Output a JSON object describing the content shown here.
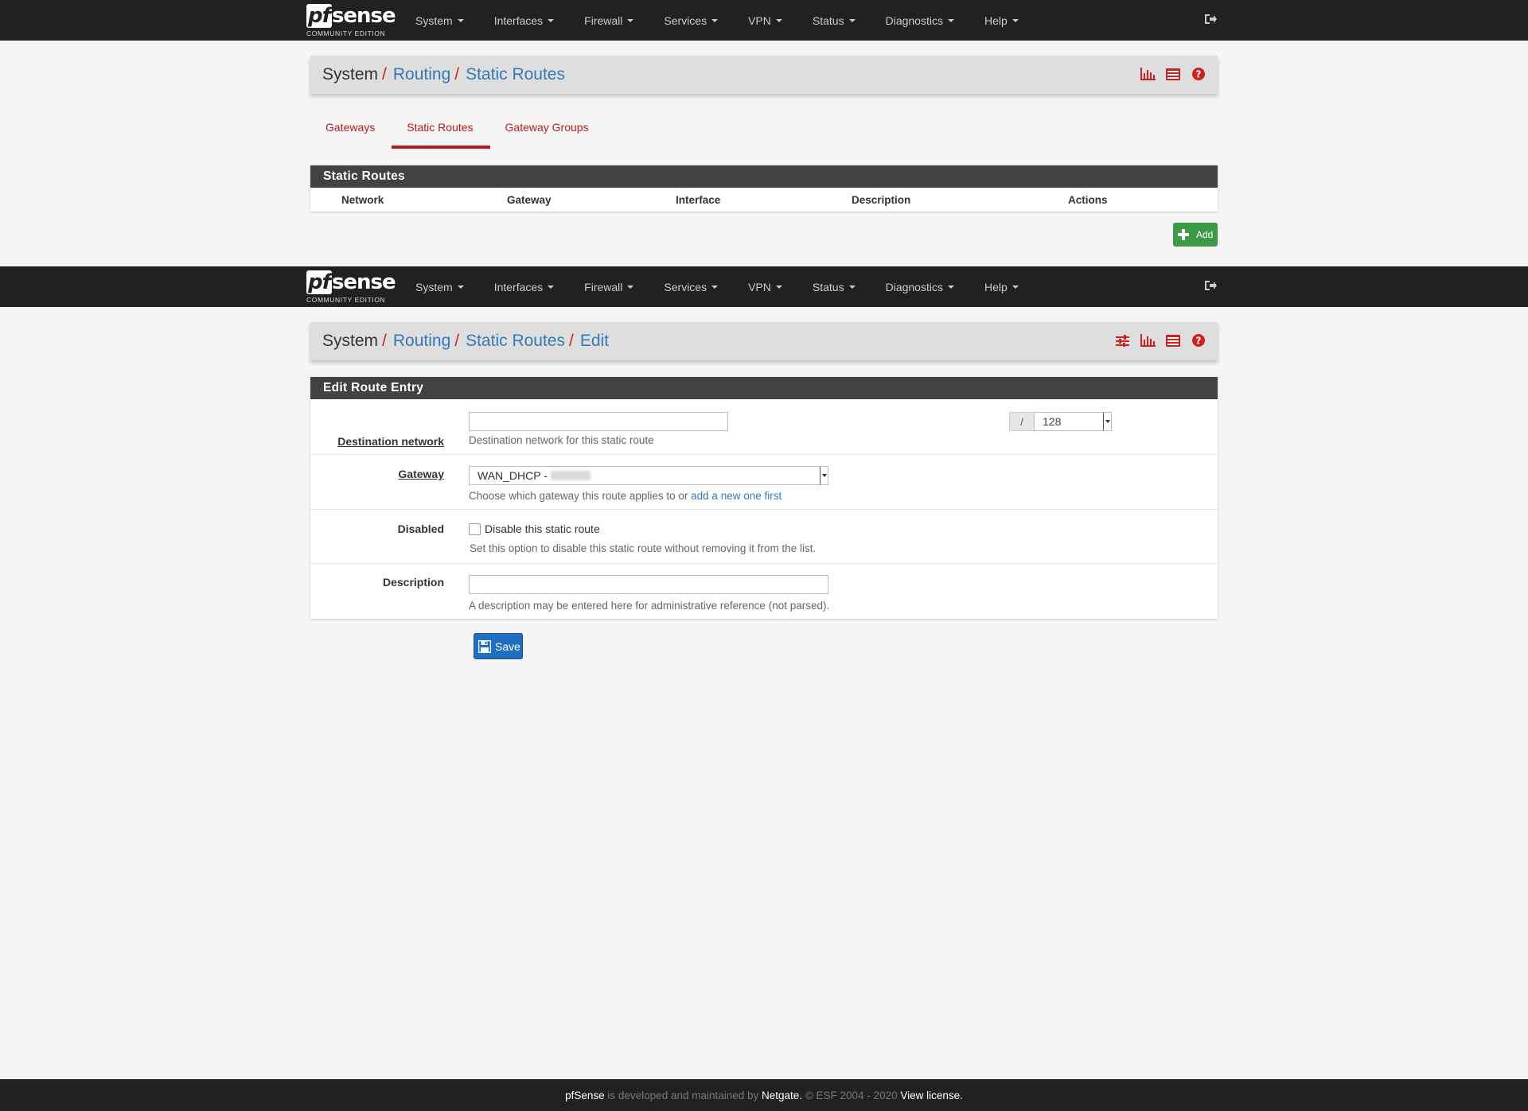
{
  "brand": {
    "logo_text": "pfsense",
    "logo_pf": "pf",
    "logo_sense": "sense",
    "edition": "COMMUNITY EDITION"
  },
  "nav": {
    "items": [
      {
        "label": "System"
      },
      {
        "label": "Interfaces"
      },
      {
        "label": "Firewall"
      },
      {
        "label": "Services"
      },
      {
        "label": "VPN"
      },
      {
        "label": "Status"
      },
      {
        "label": "Diagnostics"
      },
      {
        "label": "Help"
      }
    ],
    "logout_icon": "sign-out-icon"
  },
  "top_view": {
    "breadcrumb": {
      "root": "System",
      "level1": "Routing",
      "level2": "Static Routes"
    },
    "title_icons": [
      "bar-chart-icon",
      "list-icon",
      "help-icon"
    ],
    "tabs": [
      {
        "label": "Gateways",
        "active": false
      },
      {
        "label": "Static Routes",
        "active": true
      },
      {
        "label": "Gateway Groups",
        "active": false
      }
    ],
    "panel_title": "Static Routes",
    "columns": [
      "Network",
      "Gateway",
      "Interface",
      "Description",
      "Actions"
    ],
    "add_label": "Add"
  },
  "edit_view": {
    "breadcrumb": {
      "root": "System",
      "level1": "Routing",
      "level2": "Static Routes",
      "level3": "Edit"
    },
    "title_icons": [
      "sliders-icon",
      "bar-chart-icon",
      "list-icon",
      "help-icon"
    ],
    "panel_title": "Edit Route Entry",
    "destination": {
      "label": "Destination network",
      "value": "",
      "separator": "/",
      "cidr": "128",
      "help": "Destination network for this static route"
    },
    "gateway": {
      "label": "Gateway",
      "selected": "WAN_DHCP - ",
      "help": "Choose which gateway this route applies to or ",
      "help_link": "add a new one first"
    },
    "disabled": {
      "label": "Disabled",
      "checked": false,
      "checkbox_label": "Disable this static route",
      "help": "Set this option to disable this static route without removing it from the list."
    },
    "description": {
      "label": "Description",
      "value": "",
      "help": "A description may be entered here for administrative reference (not parsed)."
    },
    "save_label": "Save"
  },
  "footer": {
    "product": "pfSense",
    "text1": " is developed and maintained by ",
    "company": "Netgate.",
    "text2": " © ESF 2004 - 2020 ",
    "license_link": "View license."
  },
  "colors": {
    "nav_bg": "#212121",
    "link": "#347ab7",
    "accent_red": "#b71c1c",
    "add_green": "#3c9a46",
    "save_blue": "#1e6fc2"
  }
}
